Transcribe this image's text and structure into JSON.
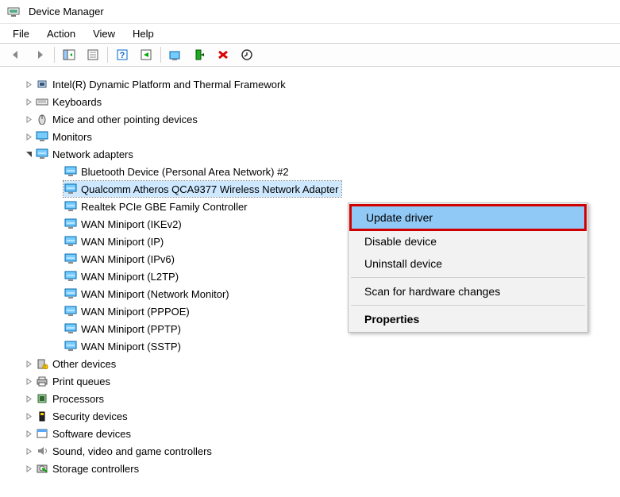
{
  "window": {
    "title": "Device Manager"
  },
  "menu": {
    "file": "File",
    "action": "Action",
    "view": "View",
    "help": "Help"
  },
  "tree": {
    "categories": [
      {
        "label": "Intel(R) Dynamic Platform and Thermal Framework",
        "expanded": false,
        "icon": "chip"
      },
      {
        "label": "Keyboards",
        "expanded": false,
        "icon": "keyboard"
      },
      {
        "label": "Mice and other pointing devices",
        "expanded": false,
        "icon": "mouse"
      },
      {
        "label": "Monitors",
        "expanded": false,
        "icon": "monitor"
      },
      {
        "label": "Network adapters",
        "expanded": true,
        "icon": "net",
        "children": [
          {
            "label": "Bluetooth Device (Personal Area Network) #2",
            "selected": false
          },
          {
            "label": "Qualcomm Atheros QCA9377 Wireless Network Adapter",
            "selected": true
          },
          {
            "label": "Realtek PCIe GBE Family Controller",
            "selected": false
          },
          {
            "label": "WAN Miniport (IKEv2)",
            "selected": false
          },
          {
            "label": "WAN Miniport (IP)",
            "selected": false
          },
          {
            "label": "WAN Miniport (IPv6)",
            "selected": false
          },
          {
            "label": "WAN Miniport (L2TP)",
            "selected": false
          },
          {
            "label": "WAN Miniport (Network Monitor)",
            "selected": false
          },
          {
            "label": "WAN Miniport (PPPOE)",
            "selected": false
          },
          {
            "label": "WAN Miniport (PPTP)",
            "selected": false
          },
          {
            "label": "WAN Miniport (SSTP)",
            "selected": false
          }
        ]
      },
      {
        "label": "Other devices",
        "expanded": false,
        "icon": "other"
      },
      {
        "label": "Print queues",
        "expanded": false,
        "icon": "printer"
      },
      {
        "label": "Processors",
        "expanded": false,
        "icon": "cpu"
      },
      {
        "label": "Security devices",
        "expanded": false,
        "icon": "security"
      },
      {
        "label": "Software devices",
        "expanded": false,
        "icon": "software"
      },
      {
        "label": "Sound, video and game controllers",
        "expanded": false,
        "icon": "sound"
      },
      {
        "label": "Storage controllers",
        "expanded": false,
        "icon": "storage"
      }
    ]
  },
  "contextMenu": {
    "items": [
      {
        "label": "Update driver",
        "highlighted": true
      },
      {
        "label": "Disable device"
      },
      {
        "label": "Uninstall device"
      },
      {
        "separator": true
      },
      {
        "label": "Scan for hardware changes"
      },
      {
        "separator": true
      },
      {
        "label": "Properties",
        "bold": true
      }
    ]
  }
}
